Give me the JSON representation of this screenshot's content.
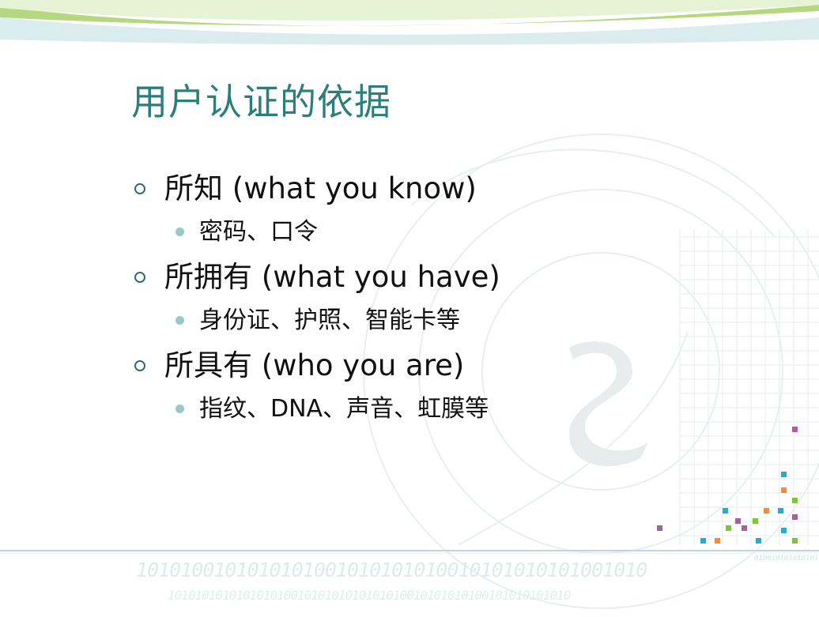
{
  "slide": {
    "title": "用户认证的依据",
    "items": [
      {
        "label": "所知 (what you know)",
        "sub": "密码、口令"
      },
      {
        "label": "所拥有 (what you have)",
        "sub": "身份证、护照、智能卡等"
      },
      {
        "label": "所具有 (who you are)",
        "sub": "指纹、DNA、声音、虹膜等"
      }
    ]
  },
  "decor": {
    "binary_row_1": "1010100101010101001010101010010101010101001010",
    "binary_row_2": "10101010101010101001010101010101010010101010100101010101010",
    "binary_row_3": "0100101010101010"
  },
  "colors": {
    "title": "#2b7f7a",
    "bullet_outline": "#2e6d72",
    "sub_bullet": "#9cc8c8",
    "text": "#111111",
    "header_green": "#8bc34a",
    "header_teal": "#9cc8cc"
  }
}
